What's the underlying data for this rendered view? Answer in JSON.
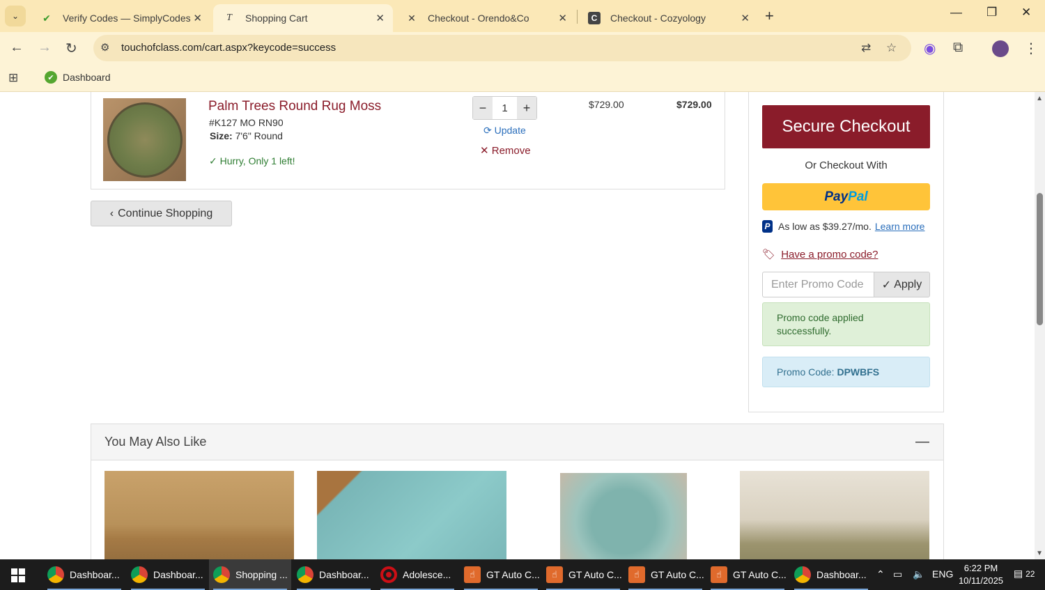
{
  "browser": {
    "tabs": [
      {
        "title": "Verify Codes — SimplyCodes",
        "active": false,
        "icon": "simplycodes-icon"
      },
      {
        "title": "Shopping Cart",
        "active": true,
        "icon": "touchofclass-icon"
      },
      {
        "title": "Checkout - Orendo&Co",
        "active": false,
        "icon": "orendo-icon"
      },
      {
        "title": "Checkout - Cozyology",
        "active": false,
        "icon": "cozyology-icon"
      }
    ],
    "url": "touchofclass.com/cart.aspx?keycode=success",
    "bookmark": "Dashboard"
  },
  "cart": {
    "item": {
      "name": "Palm Trees Round Rug Moss",
      "sku": "#K127 MO RN90",
      "size_label": "Size:",
      "size_value": "7'6\" Round",
      "stock": "Hurry, Only 1 left!",
      "qty": "1",
      "update": "Update",
      "remove": "Remove",
      "unit_price": "$729.00",
      "total_price": "$729.00"
    },
    "continue": "Continue Shopping"
  },
  "summary": {
    "secure_checkout": "Secure Checkout",
    "or_checkout": "Or Checkout With",
    "paypal_a": "Pay",
    "paypal_b": "Pal",
    "paylater_text": "As low as $39.27/mo.",
    "learn_more": "Learn more",
    "promo_link": "Have a promo code?",
    "promo_placeholder": "Enter Promo Code",
    "apply": "Apply",
    "promo_success": "Promo code applied successfully.",
    "promo_code_label": "Promo Code:",
    "promo_code_value": "DPWBFS"
  },
  "also_like": {
    "title": "You May Also Like"
  },
  "taskbar": {
    "items": [
      {
        "label": "Dashboar...",
        "icon": "chrome-icon"
      },
      {
        "label": "Dashboar...",
        "icon": "chrome-icon"
      },
      {
        "label": "Shopping ...",
        "icon": "chrome-icon"
      },
      {
        "label": "Dashboar...",
        "icon": "chrome-icon"
      },
      {
        "label": "Adolesce...",
        "icon": "opera-icon"
      },
      {
        "label": "GT Auto C...",
        "icon": "gt-auto-icon"
      },
      {
        "label": "GT Auto C...",
        "icon": "gt-auto-icon"
      },
      {
        "label": "GT Auto C...",
        "icon": "gt-auto-icon"
      },
      {
        "label": "GT Auto C...",
        "icon": "gt-auto-icon"
      },
      {
        "label": "Dashboar...",
        "icon": "chrome-icon"
      }
    ],
    "lang": "ENG",
    "time": "6:22 PM",
    "date": "10/11/2025",
    "notifications": "22"
  }
}
